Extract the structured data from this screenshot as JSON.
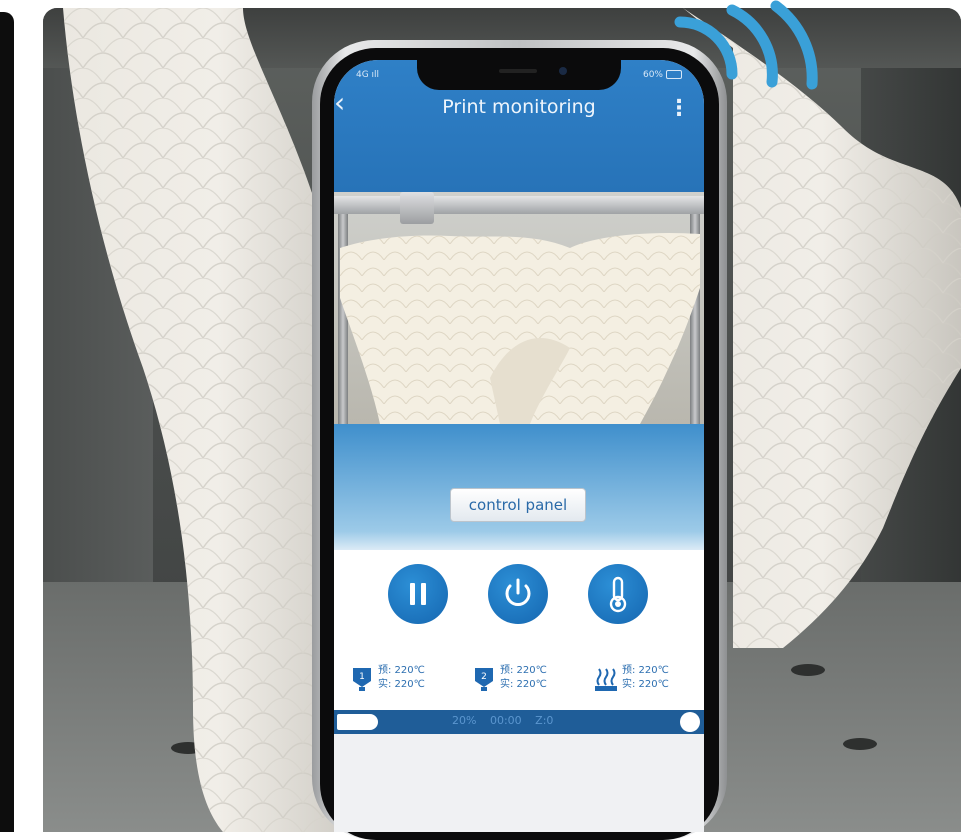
{
  "app": {
    "title": "Print monitoring",
    "back_glyph": "‹",
    "menu_glyph": "⋮",
    "status_left": "4G ıll",
    "status_right": "60%"
  },
  "panel": {
    "control_button_label": "control panel"
  },
  "controls": [
    {
      "name": "pause-button",
      "icon": "pause-icon"
    },
    {
      "name": "power-button",
      "icon": "power-icon"
    },
    {
      "name": "temperature-button",
      "icon": "thermometer-icon"
    }
  ],
  "temperatures": [
    {
      "icon": "nozzle-1-icon",
      "target": "预: 220℃",
      "actual": "实: 220℃"
    },
    {
      "icon": "nozzle-2-icon",
      "target": "预: 220℃",
      "actual": "实: 220℃"
    },
    {
      "icon": "heated-bed-icon",
      "target": "预: 220℃",
      "actual": "实: 220℃"
    }
  ],
  "progress": {
    "percent": 20,
    "percent_label": "20%",
    "time": "00:00",
    "z_label": "Z:0"
  },
  "colors": {
    "app_bar": "#2f80c7",
    "accent": "#1566b0",
    "progress_bar": "#1f5d98",
    "wifi_signal": "#3aa0d8"
  }
}
